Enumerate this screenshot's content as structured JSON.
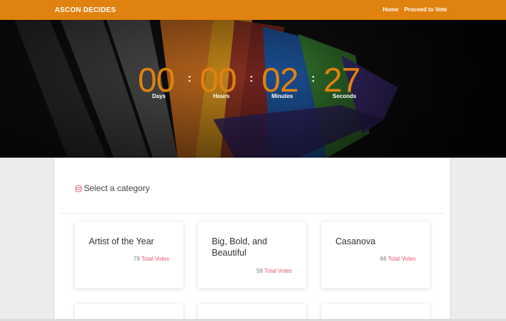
{
  "header": {
    "brand": "ASCON DECIDES",
    "nav": [
      {
        "label": "Home"
      },
      {
        "label": "Proceed to Vote"
      }
    ]
  },
  "countdown": {
    "days": "00",
    "hours": "00",
    "minutes": "02",
    "seconds": "27",
    "separator": ":",
    "labels": {
      "days": "Days",
      "hours": "Hours",
      "minutes": "Minutes",
      "seconds": "Seconds"
    }
  },
  "categories_panel": {
    "title": "Select a category",
    "title_icon": "database-icon",
    "votes_suffix": "Total Votes",
    "cards": [
      {
        "name": "Artist of the Year",
        "votes": "79"
      },
      {
        "name": "Big, Bold, and Beautiful",
        "votes": "59"
      },
      {
        "name": "Casanova",
        "votes": "66"
      }
    ]
  },
  "colors": {
    "accent": "#e0820f",
    "votes_label": "#e8556f"
  }
}
